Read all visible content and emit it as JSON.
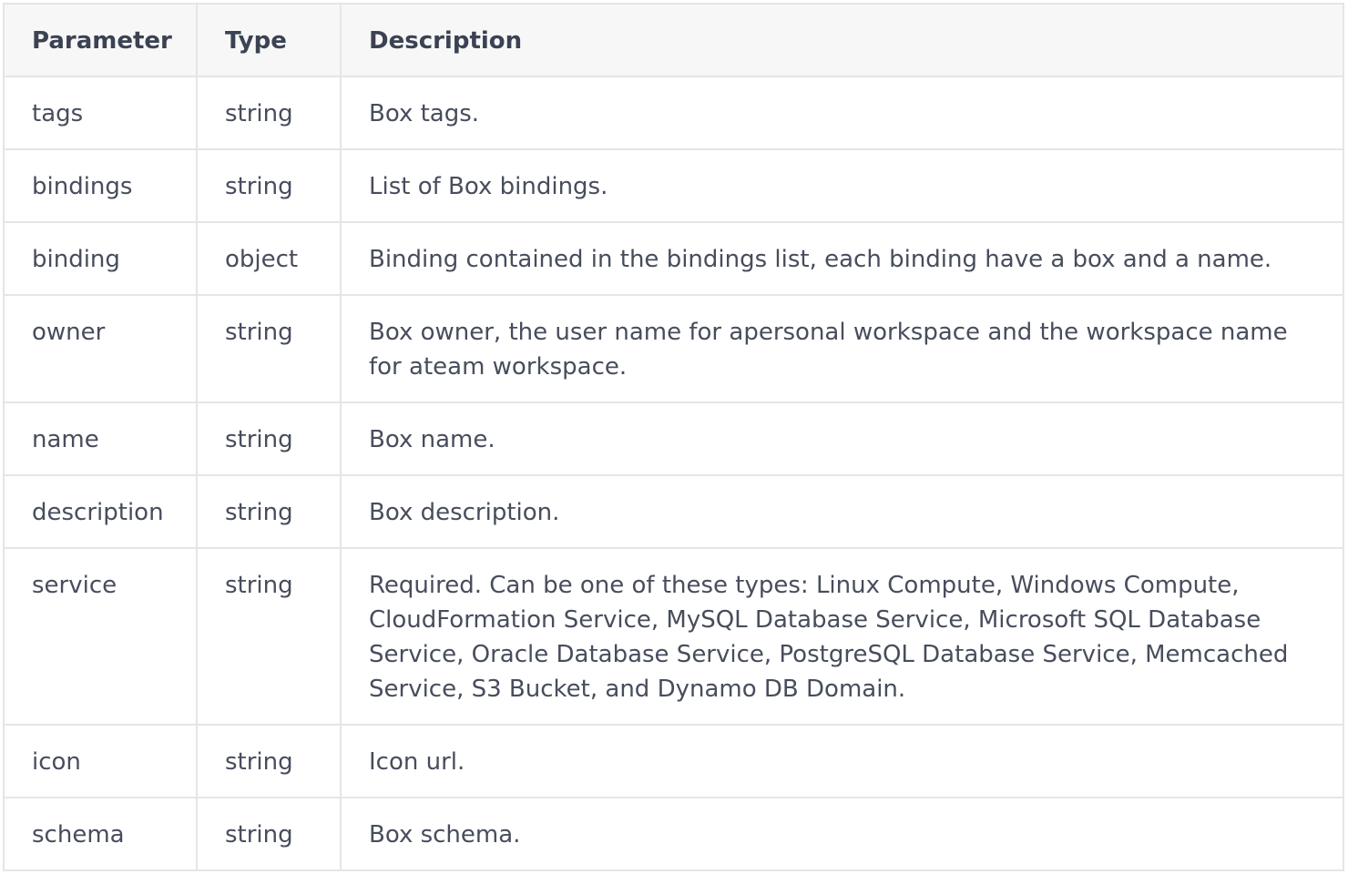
{
  "table": {
    "headers": [
      "Parameter",
      "Type",
      "Description"
    ],
    "rows": [
      {
        "parameter": "tags",
        "type": "string",
        "description": "Box tags."
      },
      {
        "parameter": "bindings",
        "type": "string",
        "description": "List of Box bindings."
      },
      {
        "parameter": "binding",
        "type": "object",
        "description": "Binding contained in the bindings list, each binding have a box and a name."
      },
      {
        "parameter": "owner",
        "type": "string",
        "description": "Box owner, the user name for apersonal workspace and the workspace name for ateam workspace."
      },
      {
        "parameter": "name",
        "type": "string",
        "description": "Box name."
      },
      {
        "parameter": "description",
        "type": "string",
        "description": "Box description."
      },
      {
        "parameter": "service",
        "type": "string",
        "description": "Required. Can be one of these types: Linux Compute, Windows Compute, CloudFormation Service, MySQL Database Service, Microsoft SQL Database Service, Oracle Database Service, PostgreSQL Database Service, Memcached Service, S3 Bucket, and Dynamo DB Domain."
      },
      {
        "parameter": "icon",
        "type": "string",
        "description": "Icon url."
      },
      {
        "parameter": "schema",
        "type": "string",
        "description": "Box schema."
      }
    ]
  },
  "colors": {
    "border": "#e5e5e8",
    "header_bg": "#f7f7f8",
    "text": "#474d5c"
  }
}
